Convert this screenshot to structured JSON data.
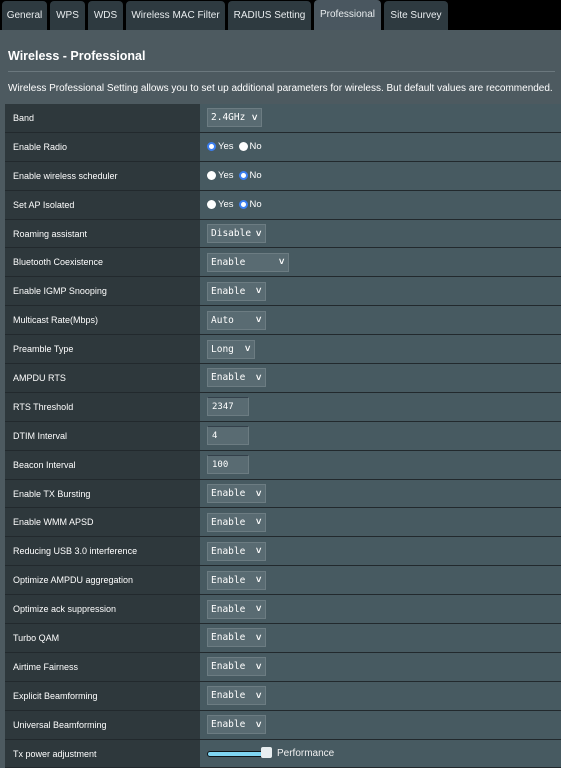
{
  "tabs": [
    {
      "label": "General",
      "active": false
    },
    {
      "label": "WPS",
      "active": false
    },
    {
      "label": "WDS",
      "active": false
    },
    {
      "label": "Wireless MAC Filter",
      "active": false
    },
    {
      "label": "RADIUS Setting",
      "active": false
    },
    {
      "label": "Professional",
      "active": true
    },
    {
      "label": "Site Survey",
      "active": false
    }
  ],
  "page": {
    "title": "Wireless - Professional",
    "description": "Wireless Professional Setting allows you to set up additional parameters for wireless. But default values are recommended."
  },
  "settings": [
    {
      "label": "Band",
      "type": "select",
      "value": "2.4GHz"
    },
    {
      "label": "Enable Radio",
      "type": "radio",
      "options": [
        "Yes",
        "No"
      ],
      "selected": "Yes"
    },
    {
      "label": "Enable wireless scheduler",
      "type": "radio",
      "options": [
        "Yes",
        "No"
      ],
      "selected": "No"
    },
    {
      "label": "Set AP Isolated",
      "type": "radio",
      "options": [
        "Yes",
        "No"
      ],
      "selected": "No"
    },
    {
      "label": "Roaming assistant",
      "type": "select",
      "value": "Disable"
    },
    {
      "label": "Bluetooth Coexistence",
      "type": "select",
      "value": "Enable"
    },
    {
      "label": "Enable IGMP Snooping",
      "type": "select",
      "value": "Enable"
    },
    {
      "label": "Multicast Rate(Mbps)",
      "type": "select",
      "value": "Auto"
    },
    {
      "label": "Preamble Type",
      "type": "select",
      "value": "Long"
    },
    {
      "label": "AMPDU RTS",
      "type": "select",
      "value": "Enable"
    },
    {
      "label": "RTS Threshold",
      "type": "input",
      "value": "2347"
    },
    {
      "label": "DTIM Interval",
      "type": "input",
      "value": "4"
    },
    {
      "label": "Beacon Interval",
      "type": "input",
      "value": "100"
    },
    {
      "label": "Enable TX Bursting",
      "type": "select",
      "value": "Enable"
    },
    {
      "label": "Enable WMM APSD",
      "type": "select",
      "value": "Enable"
    },
    {
      "label": "Reducing USB 3.0 interference",
      "type": "select",
      "value": "Enable"
    },
    {
      "label": "Optimize AMPDU aggregation",
      "type": "select",
      "value": "Enable"
    },
    {
      "label": "Optimize ack suppression",
      "type": "select",
      "value": "Enable"
    },
    {
      "label": "Turbo QAM",
      "type": "select",
      "value": "Enable"
    },
    {
      "label": "Airtime Fairness",
      "type": "select",
      "value": "Enable"
    },
    {
      "label": "Explicit Beamforming",
      "type": "select",
      "value": "Enable"
    },
    {
      "label": "Universal Beamforming",
      "type": "select",
      "value": "Enable"
    },
    {
      "label": "Tx power adjustment",
      "type": "slider",
      "value_percent": 100,
      "value_label": "Performance"
    }
  ],
  "colors": {
    "radio_selected": "#3b7ef0",
    "slider_fill": "#7fd5f2"
  }
}
